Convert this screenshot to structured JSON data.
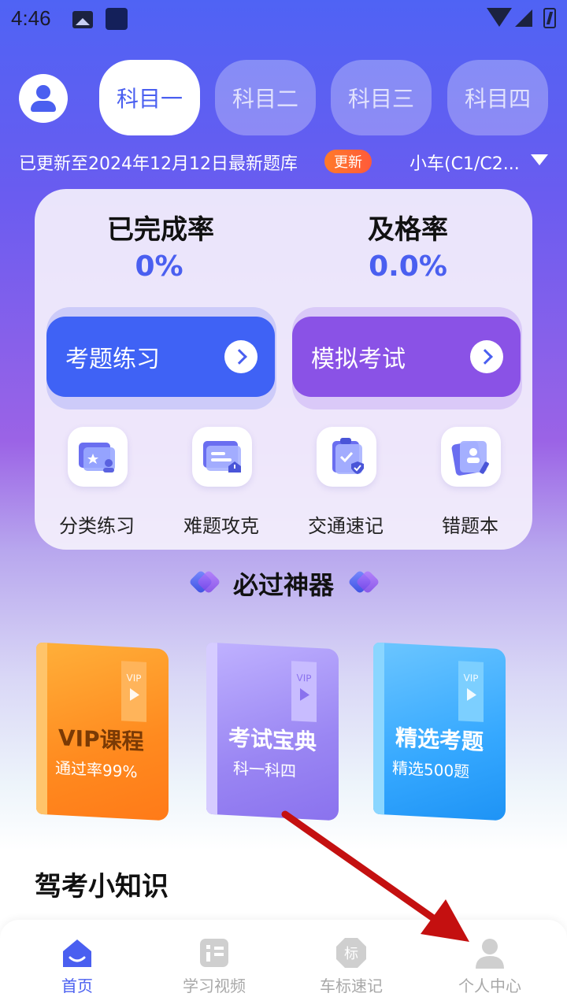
{
  "status_bar": {
    "time": "4:46"
  },
  "header": {
    "tabs": [
      "科目一",
      "科目二",
      "科目三",
      "科目四"
    ],
    "active_tab": 0,
    "update_text": "已更新至2024年12月12日最新题库",
    "update_badge": "更新",
    "car_type": "小车(C1/C2..."
  },
  "stats": {
    "completion_label": "已完成率",
    "completion_value": "0%",
    "pass_label": "及格率",
    "pass_value": "0.0%"
  },
  "actions": {
    "practice_label": "考题练习",
    "mock_exam_label": "模拟考试"
  },
  "features": [
    {
      "label": "分类练习",
      "icon": "folder-star-icon"
    },
    {
      "label": "难题攻克",
      "icon": "folder-warning-icon"
    },
    {
      "label": "交通速记",
      "icon": "clipboard-check-icon"
    },
    {
      "label": "错题本",
      "icon": "cards-person-icon"
    }
  ],
  "section": {
    "title": "必过神器"
  },
  "books": [
    {
      "ribbon": "VIP",
      "title": "VIP课程",
      "subtitle": "通过率99%",
      "color": "#ff8a1f"
    },
    {
      "ribbon": "VIP",
      "title": "考试宝典",
      "subtitle": "科一科四",
      "color": "#9a86f3"
    },
    {
      "ribbon": "VIP",
      "title": "精选考题",
      "subtitle": "精选500题",
      "color": "#35a8ff"
    }
  ],
  "tips": {
    "title": "驾考小知识"
  },
  "bottom_nav": [
    {
      "label": "首页",
      "icon": "home-icon"
    },
    {
      "label": "学习视频",
      "icon": "video-icon"
    },
    {
      "label": "车标速记",
      "icon": "car-badge-icon"
    },
    {
      "label": "个人中心",
      "icon": "person-icon"
    }
  ],
  "colors": {
    "accent": "#4a5ff0",
    "mock_exam": "#8a52e6",
    "annotation": "#c41010"
  }
}
